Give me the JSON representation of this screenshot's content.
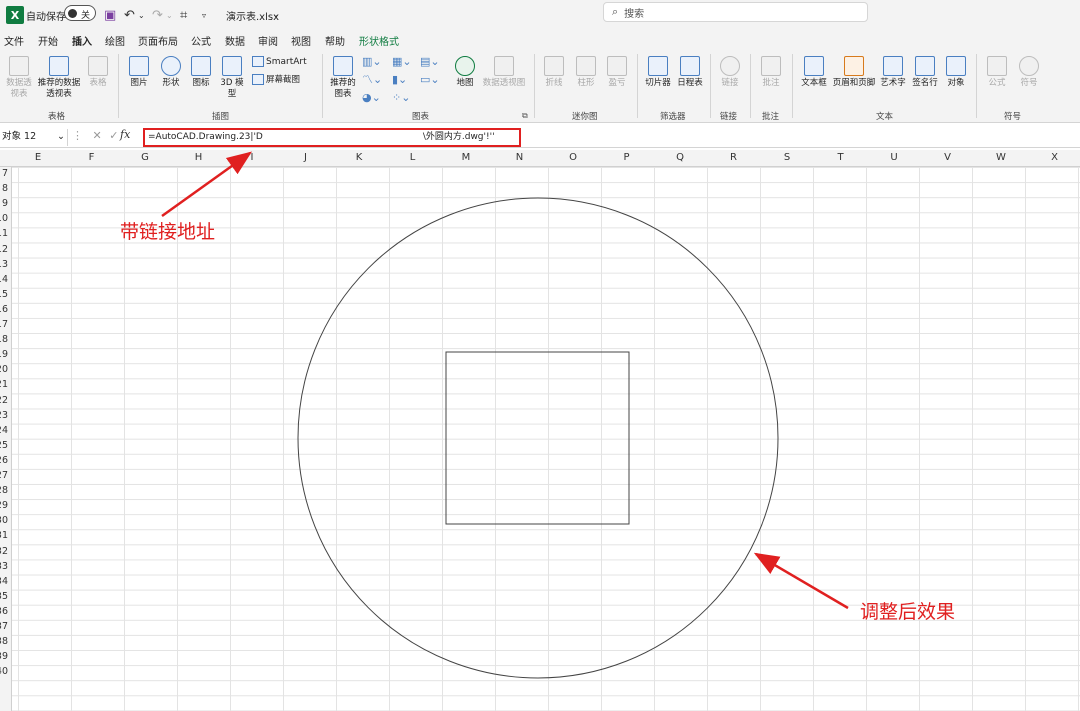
{
  "titlebar": {
    "autosave_label": "自动保存",
    "autosave_state": "关",
    "filename": "演示表.xlsx",
    "search_placeholder": "搜索"
  },
  "menu": {
    "items": [
      "文件",
      "开始",
      "插入",
      "绘图",
      "页面布局",
      "公式",
      "数据",
      "审阅",
      "视图",
      "帮助",
      "形状格式"
    ],
    "active": "插入"
  },
  "ribbon": {
    "groups": {
      "tables": "表格",
      "illustrations": "插图",
      "charts": "图表",
      "sparklines": "迷你图",
      "filters": "筛选器",
      "links": "链接",
      "comments": "批注",
      "text": "文本",
      "symbols": "符号"
    },
    "buttons": {
      "pivot_table": "数据透视表",
      "recommended_pivot": "推荐的数据透视表",
      "table": "表格",
      "pictures": "图片",
      "shapes": "形状",
      "icons": "图标",
      "models_3d": "3D 模型",
      "smartart": "SmartArt",
      "screenshot": "屏幕截图",
      "recommended_charts": "推荐的图表",
      "maps": "地图",
      "pivot_chart": "数据透视图",
      "line": "折线",
      "column": "柱形",
      "win_loss": "盈亏",
      "slicer": "切片器",
      "timeline": "日程表",
      "link": "链接",
      "comment": "批注",
      "text_box": "文本框",
      "header_footer": "页眉和页脚",
      "wordart": "艺术字",
      "signature_line": "签名行",
      "object": "对象",
      "equation": "公式",
      "symbol": "符号"
    }
  },
  "formula_bar": {
    "name_box": "对象 12",
    "fx": "fx",
    "formula_start": "=AutoCAD.Drawing.23|'D",
    "formula_end": "\\外圆内方.dwg'!''"
  },
  "columns": [
    "E",
    "F",
    "G",
    "H",
    "I",
    "J",
    "K",
    "L",
    "M",
    "N",
    "O",
    "P",
    "Q",
    "R",
    "S",
    "T",
    "U",
    "V",
    "W",
    "X"
  ],
  "rows": [
    "7",
    "8",
    "9",
    "10",
    "11",
    "12",
    "13",
    "14",
    "15",
    "16",
    "17",
    "18",
    "19",
    "20",
    "21",
    "22",
    "23",
    "24",
    "25",
    "26",
    "27",
    "28",
    "29",
    "30",
    "31",
    "32",
    "33",
    "34",
    "35",
    "36",
    "37",
    "38",
    "39",
    "40"
  ],
  "annotations": {
    "link_address": "带链接地址",
    "adjusted_effect": "调整后效果"
  },
  "colors": {
    "excel_green": "#107c41",
    "annotation_red": "#e02020"
  }
}
